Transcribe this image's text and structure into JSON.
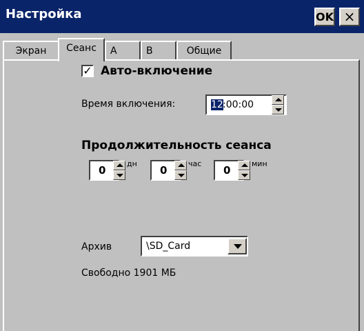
{
  "window": {
    "title": "Настройка",
    "ok_label": "OK",
    "close_label": "×"
  },
  "tabs": [
    {
      "label": "Экран",
      "active": false
    },
    {
      "label": "Сеанс",
      "active": true
    },
    {
      "label": "A",
      "active": false
    },
    {
      "label": "B",
      "active": false
    },
    {
      "label": "Общие",
      "active": false
    }
  ],
  "session": {
    "auto_on": {
      "label": "Авто-включение",
      "checked": true,
      "check_glyph": "✓"
    },
    "start_time": {
      "label": "Время включения:",
      "hours": "12",
      "rest": ":00:00"
    },
    "duration": {
      "title": "Продолжительность сеанса",
      "days": {
        "value": "0",
        "unit": "дн"
      },
      "hours": {
        "value": "0",
        "unit": "час"
      },
      "minutes": {
        "value": "0",
        "unit": "мин"
      }
    },
    "archive": {
      "label": "Архив",
      "value": "\\SD_Card"
    },
    "free_space": "Свободно 1901 МБ"
  },
  "colors": {
    "titlebar": "#0a246a",
    "face": "#c0c0c0",
    "selection": "#0a246a"
  }
}
